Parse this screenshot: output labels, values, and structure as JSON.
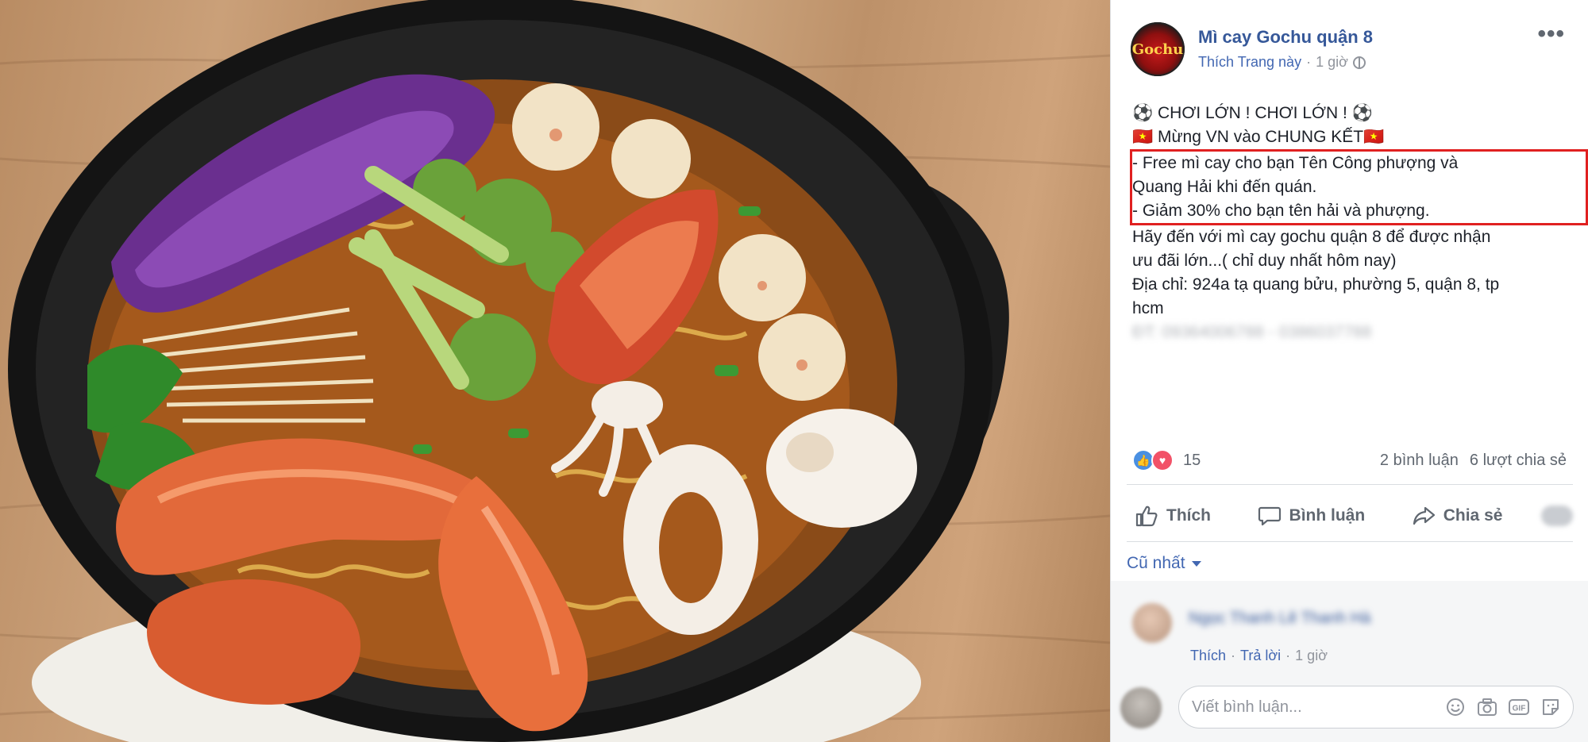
{
  "post": {
    "page_name": "Mì cay Gochu quận 8",
    "avatar_text": "Gochu",
    "like_page": "Thích Trang này",
    "time_sep": "·",
    "time": "1 giờ",
    "more": "•••",
    "lines": [
      "⚽ CHƠI LỚN ! CHƠI LỚN ! ⚽",
      "🇻🇳 Mừng VN vào CHUNG KẾT🇻🇳"
    ],
    "highlighted_lines": [
      "- Free mì cay cho bạn Tên Công phượng và",
      "Quang Hải khi đến quán.",
      "- Giảm 30% cho bạn tên hải và phượng."
    ],
    "after_lines": [
      "Hãy đến với mì cay gochu quận 8 để được nhận",
      "ưu đãi lớn...( chỉ duy nhất hôm nay)",
      "Địa chỉ: 924a tạ quang bửu, phường 5, quận 8, tp",
      "hcm"
    ],
    "blurred_phone": "ĐT: 09364006788 - 0386037788"
  },
  "stats": {
    "reaction_count": "15",
    "comments": "2 bình luận",
    "shares": "6 lượt chia sẻ"
  },
  "actions": {
    "like": "Thích",
    "comment": "Bình luận",
    "share": "Chia sẻ"
  },
  "comments": {
    "sort_label": "Cũ nhất",
    "items": [
      {
        "name": "Ngọc Thanh Lê Thanh Hà",
        "like": "Thích",
        "dot1": "·",
        "reply": "Trả lời",
        "dot2": "·",
        "time": "1 giờ"
      }
    ],
    "compose_placeholder": "Viết bình luận..."
  },
  "colors": {
    "link": "#365899",
    "highlight_border": "#e02020",
    "like_blue": "#4a90e2",
    "love_red": "#f25268"
  },
  "icons": [
    "globe-icon",
    "more-icon",
    "thumbs-up-icon",
    "speech-bubble-icon",
    "share-arrow-icon",
    "emoji-icon",
    "camera-icon",
    "gif-icon",
    "sticker-icon",
    "caret-down-icon"
  ]
}
